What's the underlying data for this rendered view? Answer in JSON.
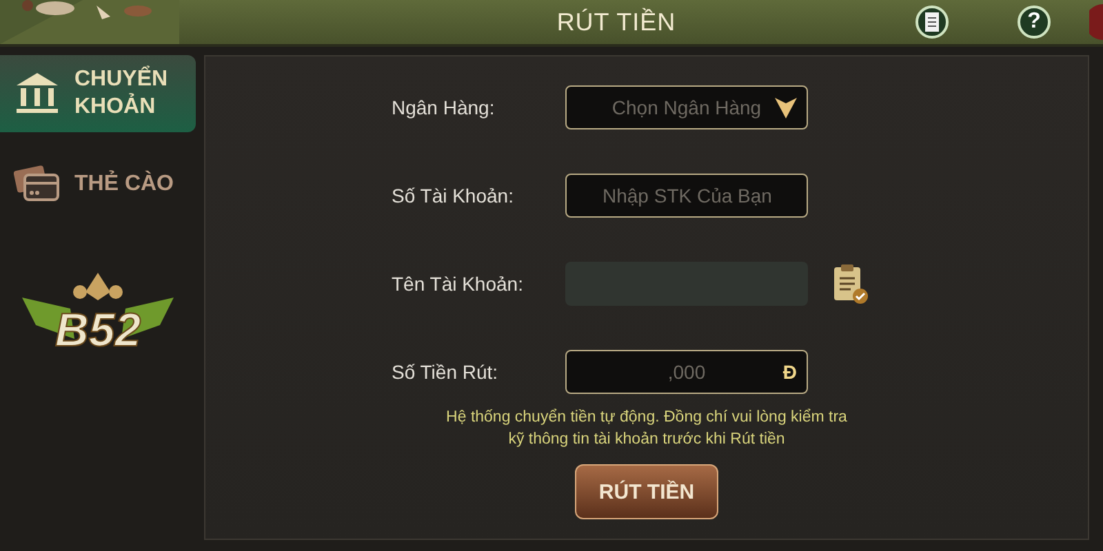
{
  "header": {
    "title": "RÚT TIỀN",
    "help_label": "?"
  },
  "sidebar": {
    "items": [
      {
        "kind": "bank",
        "label_lines": [
          "CHUYỂN",
          "KHOẢN"
        ],
        "selected": true
      },
      {
        "kind": "card",
        "label_lines": [
          "THẺ CÀO"
        ],
        "selected": false
      }
    ],
    "logo": {
      "text": "B52"
    }
  },
  "form": {
    "fields": [
      {
        "kind": "select",
        "label": "Ngân Hàng:",
        "placeholder": "Chọn Ngân Hàng"
      },
      {
        "kind": "text",
        "label": "Số Tài Khoản:",
        "placeholder": "Nhập STK Của Bạn"
      },
      {
        "kind": "readonly",
        "label": "Tên Tài Khoản:",
        "disabled": true
      },
      {
        "kind": "amount",
        "label": "Số Tiền Rút:",
        "placeholder": ",000",
        "suffix": "Đ"
      }
    ],
    "note_lines": [
      "Hệ thống chuyển tiền tự động. Đồng chí vui lòng kiểm tra",
      "kỹ thông tin tài khoản trước khi Rút tiền"
    ],
    "submit": "RÚT TIỀN"
  }
}
